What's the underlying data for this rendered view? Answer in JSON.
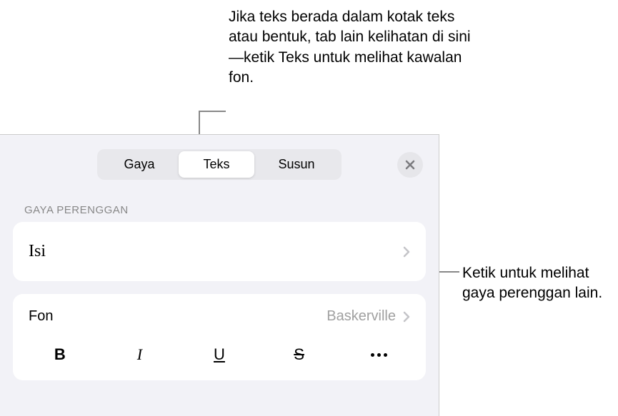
{
  "callouts": {
    "top": "Jika teks berada dalam kotak teks atau bentuk, tab lain kelihatan di sini—ketik Teks untuk melihat kawalan fon.",
    "right": "Ketik untuk melihat gaya perenggan lain."
  },
  "tabs": {
    "items": [
      "Gaya",
      "Teks",
      "Susun"
    ],
    "active_index": 1
  },
  "section": {
    "paragraph_style_label": "GAYA PERENGGAN",
    "style_name": "Isi"
  },
  "font": {
    "label": "Fon",
    "value": "Baskerville"
  },
  "format": {
    "bold": "B",
    "italic": "I",
    "underline": "U",
    "strike": "S"
  }
}
